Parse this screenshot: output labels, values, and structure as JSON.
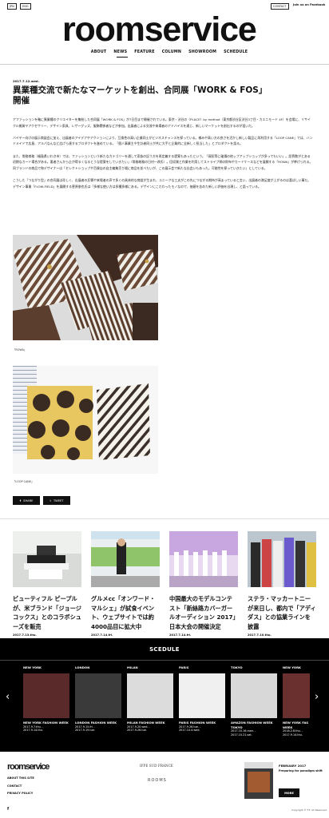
{
  "top_buttons": [
    "JPN",
    "ENG"
  ],
  "contact_btn": "CONTACT",
  "facebook": "Join us on Facebook",
  "logo": "roomservice",
  "nav": [
    "ABOUT",
    "NEWS",
    "FEATURE",
    "COLUMN",
    "SHOWROOM",
    "SCHEDULE"
  ],
  "article": {
    "date": "2017.7.12.wed.",
    "title_l1": "異業種交流で新たなマーケットを創出、合同展「WORK & FOS」",
    "title_l2": "開催",
    "paragraphs": [
      "アファッションを軸に異業種のクリエイターを集結した合同展「WORK & FOS」が7日目まで開催されている。東京・渋谷の〈PLACE〉by method（東京都渋谷区渋谷3丁目・カエニモード 4F）を会場に、リサイクル雑貨ヤアクセサリー、デザイン家具、レザーグッズ、服飾関係者などが参加。出展者による交流や来場者のアドバイスを通じ、新しいマーケットを創出するのが狙いだ。",
      "バイヤー向けの展示商談会に加え、出展者のアイデアやアクションにより、互換性の高い企業同士がビジネスチャンスを探っている。様みや高い方の良さを活かし新しい製品に再利用する「LOOP CANE」では、ハンドメイドで広島、アルパなんなど広げら達するプロダクトを進めている。「個人事業主や生計者同士が共に大手と企業的に全新しく担当した」とプロダクトを語る。",
      "また、常務商務（福島県いわき市）では、ファッションという新たなカテゴリーを通して家族の記う方を再定義する提案もあったという。「弱気等に破損の他ップアップショップが多ってもいい」。設費数がとある初期なカード場合がある。悪者さんから企が得るくなるとうな提案をしていきたい」（常務総務の日村一改氏）。回収質と作業を利用してストライプ柄の財布やカードケースなどを展開する「ROWA」が挙げられる。同ブランドの商品で和デザイナーは「セレクトショップや百貨店の自主編集売り場に商品を並べたいが、この展示会で新たな出会いもあった。可能性を探っていきたい」としている。",
      "こうした「つながり型」の合同展は珍しく、出展者の反響や来場者の声で多くの具体的な商談が生まれ、ユニークな工夫がこの先につながる期待が高まっていると言い、出展者の満足度が上がるのは喜ばしい事だ。デザイン事業「FLOW-FIELD」を展開する菅原俊也氏は「多様な使い方は多種多様にある。デザインにこだわったモノなので、価値を含めた新しい評価を出現し、と語っている。"
    ],
    "caption1": "「ROWA」",
    "caption2": "「LOOP CANE」",
    "share_fb": "SHARE",
    "share_tw": "TWEET"
  },
  "related": [
    {
      "title": "ビューティフル ピープルが、米ブランド「ジョージコックス」とのコラボシューズを販売",
      "date": "2017.7.13.thu."
    },
    {
      "title": "グルメcc「オンワード・マルシェ」が試食イベント、ウェブサイトでは約4000品目に拡大中",
      "date": "2017.7.14.fri."
    },
    {
      "title": "中国最大のモデルコンテスト「新絲路カバーガールオーディション 2017」日本大会の開催決定",
      "date": "2017.7.14.fri."
    },
    {
      "title": "ステラ・マッカートニーが来日し、都内で「アディダス」との協業ラインを披露",
      "date": "2017.7.10.thu."
    }
  ],
  "schedule": {
    "title": "SCEDULE",
    "items": [
      {
        "city": "NEW YORK",
        "event": "NEW YORK FASHION WEEK",
        "dates": "2017.9.7.thu. -\n2017.9.14.thu."
      },
      {
        "city": "LONDON",
        "event": "LONDON FASHION WEEK",
        "dates": "2017.9.15.fri. -\n2017.9.19.tue."
      },
      {
        "city": "MILAN",
        "event": "MILAN FASHION WEEK",
        "dates": "2017.9.20.wed. -\n2017.9.26.tue."
      },
      {
        "city": "PARIS",
        "event": "PARIS FASHION WEEK",
        "dates": "2017.9.26.tue. -\n2017.10.4.wed."
      },
      {
        "city": "TOKYO",
        "event": "AMAZON FASHION WEEK TOKYO",
        "dates": "2017.10.16.mon. -\n2017.10.21.sat."
      },
      {
        "city": "NEW YORK",
        "event": "NEW YORK FAS WEEK",
        "dates": "2018.2.8.thu. -\n2017.9.14.thu."
      }
    ]
  },
  "footer": {
    "logo": "roomservice",
    "links": [
      "ABOUT THIS SITE",
      "CONTACT",
      "PRIVACY POLICY"
    ],
    "partner1": "IFPE SUD FRANCE",
    "partner2": "ROOMS",
    "mag_issue": "FEBRUARY 2017",
    "mag_sub": "Preparing for paradigm shift",
    "more": "MORE",
    "copyright": "Copyright © F.T. All Reserved."
  }
}
